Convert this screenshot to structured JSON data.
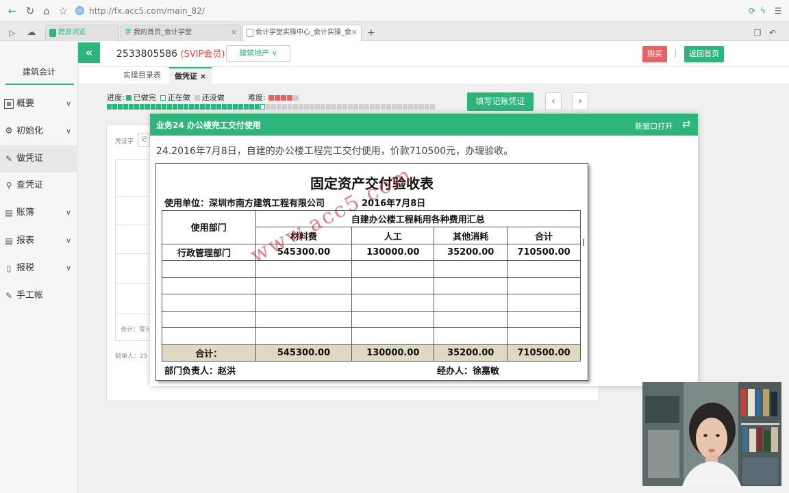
{
  "browser": {
    "url": "http://fx.acc5.com/main_82/",
    "tabs": [
      {
        "label": "跨屏浏览",
        "color": "#2db57a"
      },
      {
        "label": "我的首页_会计学堂",
        "color": "#2db57a"
      },
      {
        "label": "会计学堂实操中心_会计实操_会",
        "color": "#888888"
      }
    ]
  },
  "header": {
    "user_id": "2533805586",
    "vip": "(SVIP会员)",
    "industry": "建筑地产 ∨",
    "buy": "购买",
    "separator": "|",
    "home": "返回首页"
  },
  "sidebar": {
    "brand": "建筑会计",
    "items": [
      {
        "label": "概要",
        "icon": "overview-icon"
      },
      {
        "label": "初始化",
        "icon": "gear-icon"
      },
      {
        "label": "做凭证",
        "icon": "pen-icon"
      },
      {
        "label": "查凭证",
        "icon": "search-icon"
      },
      {
        "label": "账簿",
        "icon": "book-icon"
      },
      {
        "label": "报表",
        "icon": "report-icon"
      },
      {
        "label": "报税",
        "icon": "tax-icon"
      },
      {
        "label": "手工帐",
        "icon": "pen-icon"
      }
    ]
  },
  "inner_tabs": [
    {
      "label": "实操目录表"
    },
    {
      "label": "做凭证",
      "close": "×"
    }
  ],
  "progress": {
    "label": "进度:",
    "done": "已做完",
    "doing": "正在做",
    "todo": "还没做",
    "difficulty_label": "难度:",
    "difficulty_stars": 4,
    "difficulty_max": 5,
    "completed": 28,
    "current": 29,
    "total": 60
  },
  "toolbar": {
    "fill_button": "填写记账凭证",
    "prev": "‹",
    "next": "›"
  },
  "voucher_bg": {
    "word_label": "凭证字",
    "word_value": "记",
    "total_label": "合计：零元",
    "maker_label": "制单人：25"
  },
  "popup": {
    "title": "业务24 办公楼完工交付使用",
    "new_window": "新窗口打开",
    "swap_icon": "⇄",
    "description": "24.2016年7月8日，自建的办公楼工程完工交付使用，价款710500元，办理验收。"
  },
  "document": {
    "title": "固定资产交付验收表",
    "unit": "使用单位：深圳市南方建筑工程有限公司",
    "date": "2016年7月8日",
    "dept_header": "使用部门",
    "group_header": "自建办公楼工程耗用各种费用汇总",
    "col_headers": [
      "材料费",
      "人工",
      "其他消耗",
      "合计"
    ],
    "rows": [
      {
        "dept": "行政管理部门",
        "values": [
          "545300.00",
          "130000.00",
          "35200.00",
          "710500.00"
        ]
      }
    ],
    "total_label": "合计：",
    "totals": [
      "545300.00",
      "130000.00",
      "35200.00",
      "710500.00"
    ],
    "manager": "部门负责人：赵洪",
    "clerk": "经办人：徐嘉敏",
    "watermark": "www.acc5.com"
  }
}
